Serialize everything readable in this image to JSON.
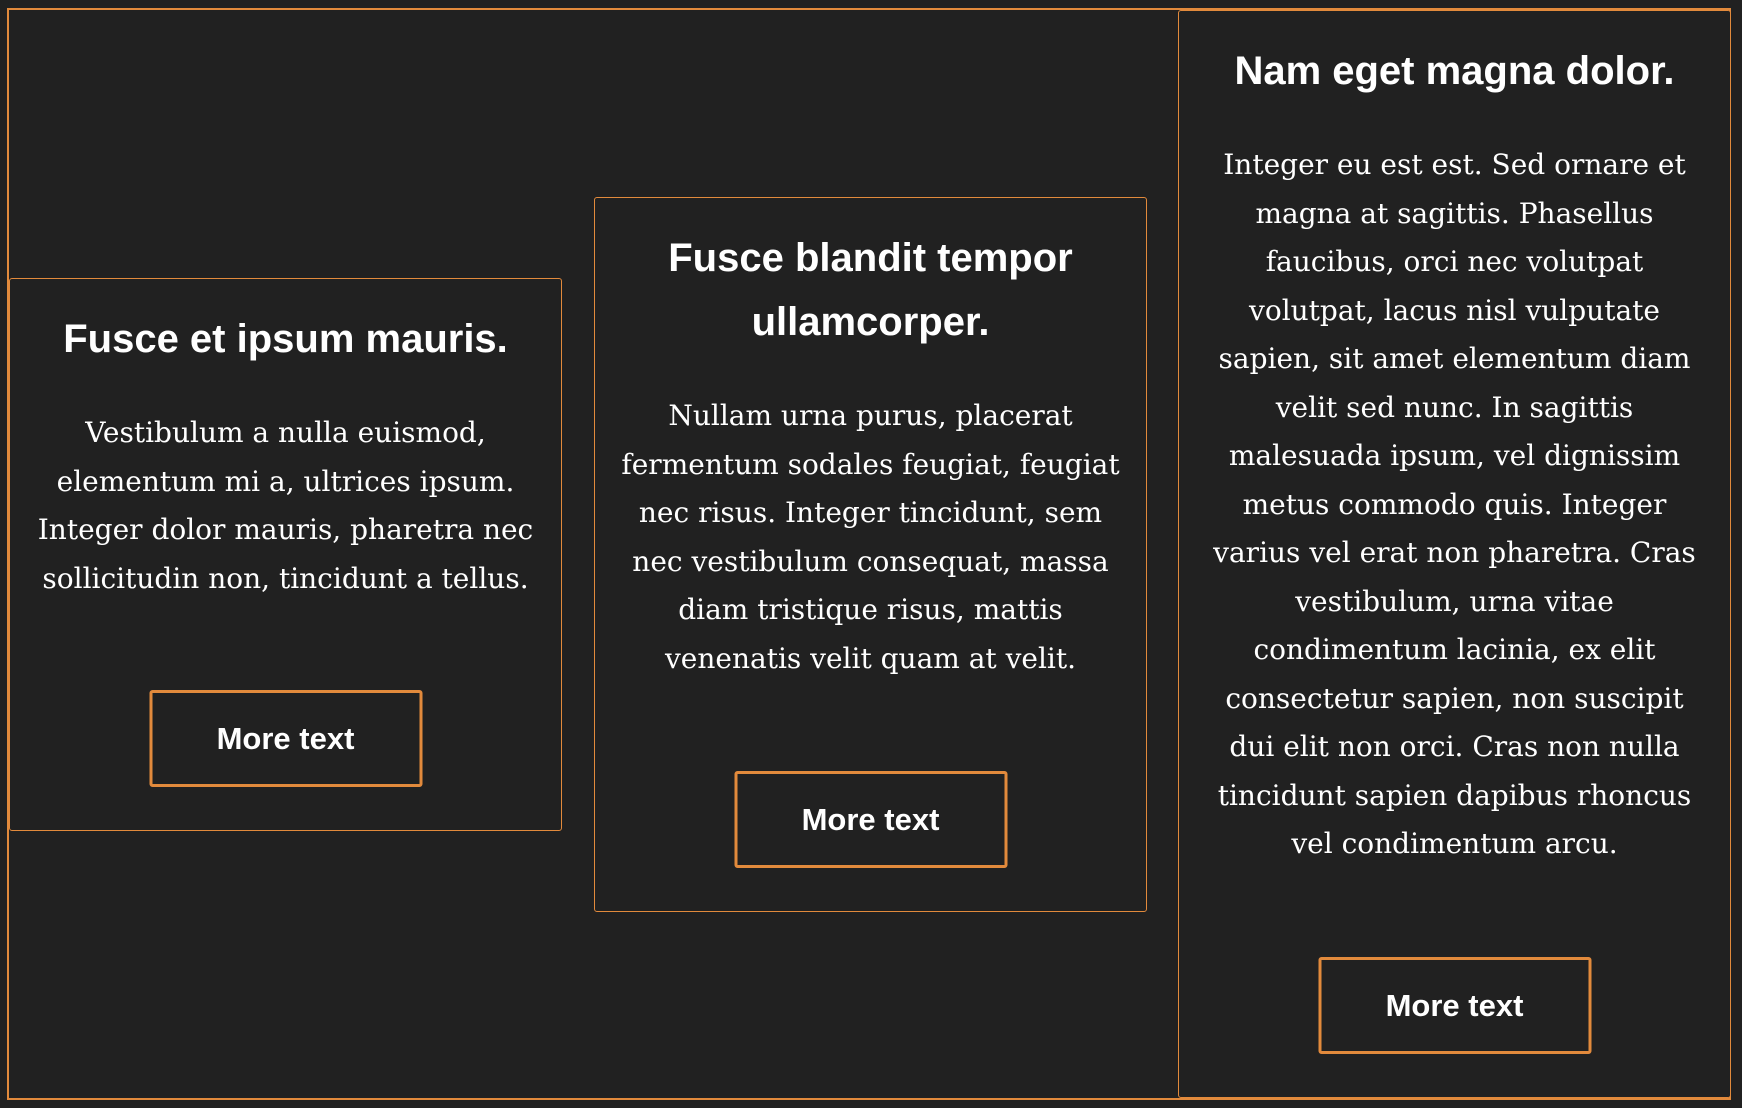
{
  "colors": {
    "background": "#212121",
    "accent": "#e28a3c",
    "text": "#ffffff"
  },
  "cards": [
    {
      "title": "Fusce et ipsum mauris.",
      "body": "Vestibulum a nulla euismod, elementum mi a, ultrices ipsum. Integer dolor mauris, pharetra nec sollicitudin non, tincidunt a tellus.",
      "button_label": "More text"
    },
    {
      "title": "Fusce blandit tempor ullamcorper.",
      "body": "Nullam urna purus, placerat fermentum sodales feugiat, feugiat nec risus. Integer tincidunt, sem nec vestibulum consequat, massa diam tristique risus, mattis venenatis velit quam at velit.",
      "button_label": "More text"
    },
    {
      "title": "Nam eget magna dolor.",
      "body": "Integer eu est est. Sed ornare et magna at sagittis. Phasellus faucibus, orci nec volutpat volutpat, lacus nisl vulputate sapien, sit amet elementum diam velit sed nunc. In sagittis malesuada ipsum, vel dignissim metus commodo quis. Integer varius vel erat non pharetra. Cras vestibulum, urna vitae condimentum lacinia, ex elit consectetur sapien, non suscipit dui elit non orci. Cras non nulla tincidunt sapien dapibus rhoncus vel condimentum arcu.",
      "button_label": "More text"
    }
  ]
}
